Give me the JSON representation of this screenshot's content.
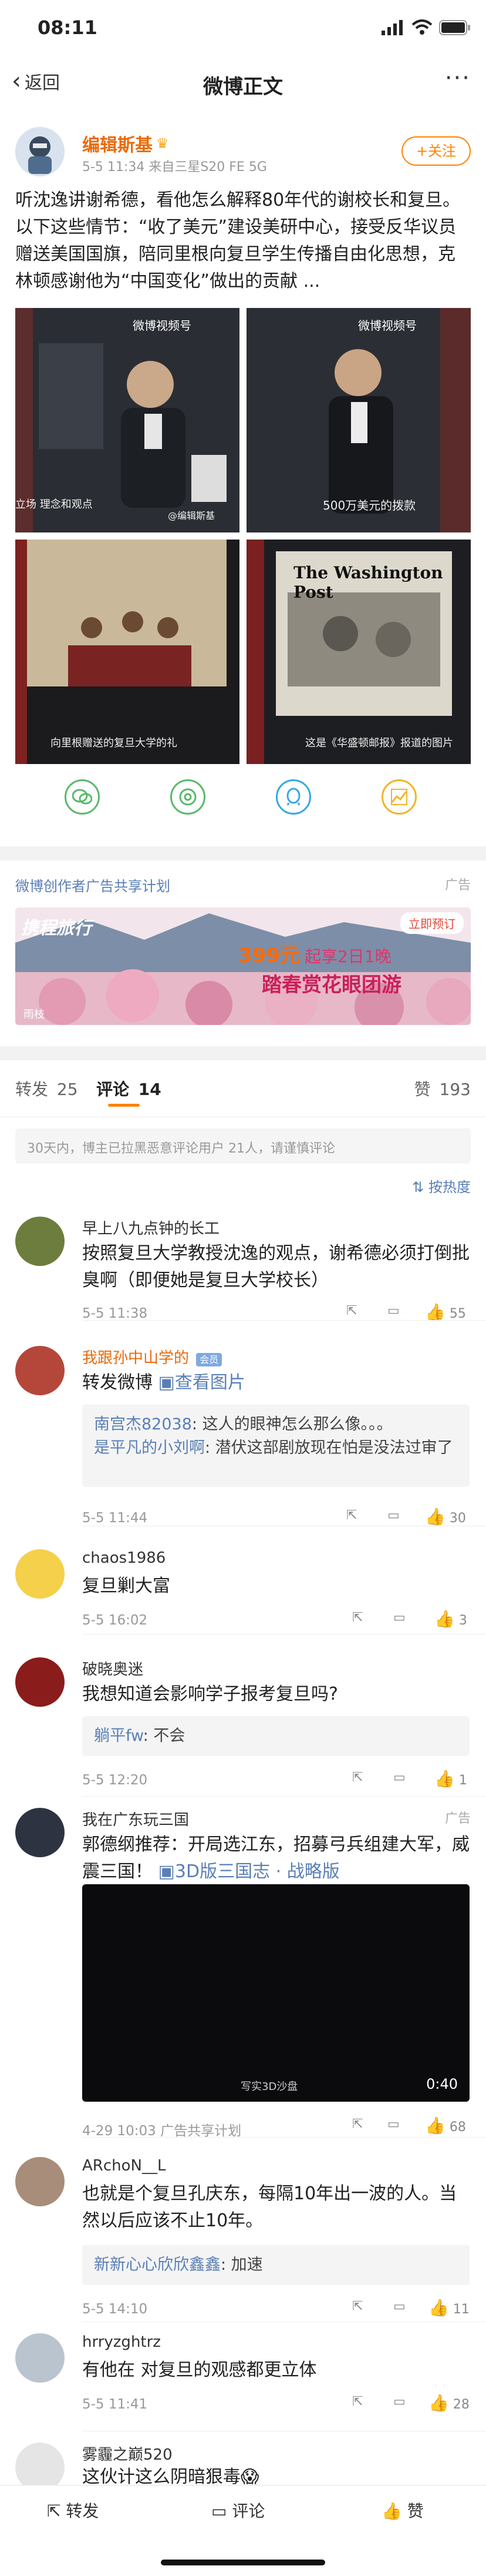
{
  "status_bar": {
    "time": "08:11"
  },
  "nav": {
    "back_label": "返回",
    "title": "微博正文",
    "more": "···"
  },
  "post": {
    "author": "编辑斯基",
    "crown": "♛",
    "meta": "5-5 11:34  来自三星S20 FE 5G",
    "follow_label": "+关注",
    "text": "听沈逸讲谢希德，看他怎么解释80年代的谢校长和复旦。以下这些情节：“收了美元”建设美研中心，接受反华议员赠送美国国旗，陪同里根向复旦学生传播自由化思想，克林顿感谢他为“中国变化”做出的贡献 ...",
    "images": [
      {
        "watermark": "微博视频号",
        "caption": "立场 理念和观点",
        "tag": "@编辑斯基"
      },
      {
        "watermark": "微博视频号",
        "caption": "500万美元的拨款"
      },
      {
        "caption": "向里根赠送的复旦大学的礼"
      },
      {
        "headline": "The Washington Post",
        "caption": "这是《华盛顿邮报》报道的图片"
      }
    ],
    "share_icons": [
      "wechat-icon",
      "moments-icon",
      "qq-icon",
      "chart-icon"
    ]
  },
  "ad": {
    "header": "微博创作者广告共享计划",
    "tag": "广告",
    "brand": "携程旅行",
    "badge": "立即预订",
    "price": "399元",
    "slogan_1": "起享2日1晚",
    "slogan_2": "踏春赏花眼团游",
    "location": "雨枝"
  },
  "tabs": {
    "repost_label": "转发",
    "repost_count": "25",
    "comment_label": "评论",
    "comment_count": "14",
    "like_label": "赞",
    "like_count": "193"
  },
  "notice": "30天内，博主已拉黑恶意评论用户 21人，请谨慎评论",
  "sort_label": "按热度",
  "comments": [
    {
      "name": "早上八九点钟的长工",
      "text": "按照复旦大学教授沈逸的观点，谢希德必须打倒批臭啊（即便她是复旦大学校长）",
      "time": "5-5 11:38",
      "likes": "55"
    },
    {
      "name": "我跟孙中山学的",
      "vip": "会员",
      "text": "转发微博",
      "link": "查看图片",
      "replies": [
        {
          "user": "南宫杰82038",
          "text": ": 这人的眼神怎么那么像。。。"
        },
        {
          "user": "是平凡的小刘啊",
          "text": ": 潜伏这部剧放现在怕是没法过审了"
        }
      ],
      "time": "5-5 11:44",
      "likes": "30"
    },
    {
      "name": "chaos1986",
      "text": "复旦剿大富",
      "time": "5-5 16:02",
      "likes": "3"
    },
    {
      "name": "破晓奥迷",
      "text": "我想知道会影响学子报考复旦吗?",
      "replies": [
        {
          "user": "躺平fw",
          "text": ": 不会"
        }
      ],
      "time": "5-5 12:20",
      "likes": "1"
    },
    {
      "name": "我在广东玩三国",
      "ad_tag": "广告",
      "text": "郭德纲推荐：开局选江东，招募弓兵组建大军，威震三国！",
      "link": "3D版三国志 · 战略版",
      "video_caption": "写实3D沙盘",
      "video_duration": "0:40",
      "time": "4-29 10:03  广告共享计划",
      "likes": "68"
    },
    {
      "name": "ARchoN__L",
      "text": "也就是个复旦孔庆东，每隔10年出一波的人。当然以后应该不止10年。",
      "replies": [
        {
          "user": "新新心心欣欣鑫鑫",
          "text": ": 加速"
        }
      ],
      "time": "5-5 14:10",
      "likes": "11"
    },
    {
      "name": "hrryzghtrz",
      "text": "有他在 对复旦的观感都更立体",
      "time": "5-5 11:41",
      "likes": "28"
    },
    {
      "name": "雾霾之巅520",
      "text": "这伙计这么阴暗狠毒😱"
    }
  ],
  "bottom": {
    "repost": "转发",
    "comment": "评论",
    "like": "赞"
  }
}
